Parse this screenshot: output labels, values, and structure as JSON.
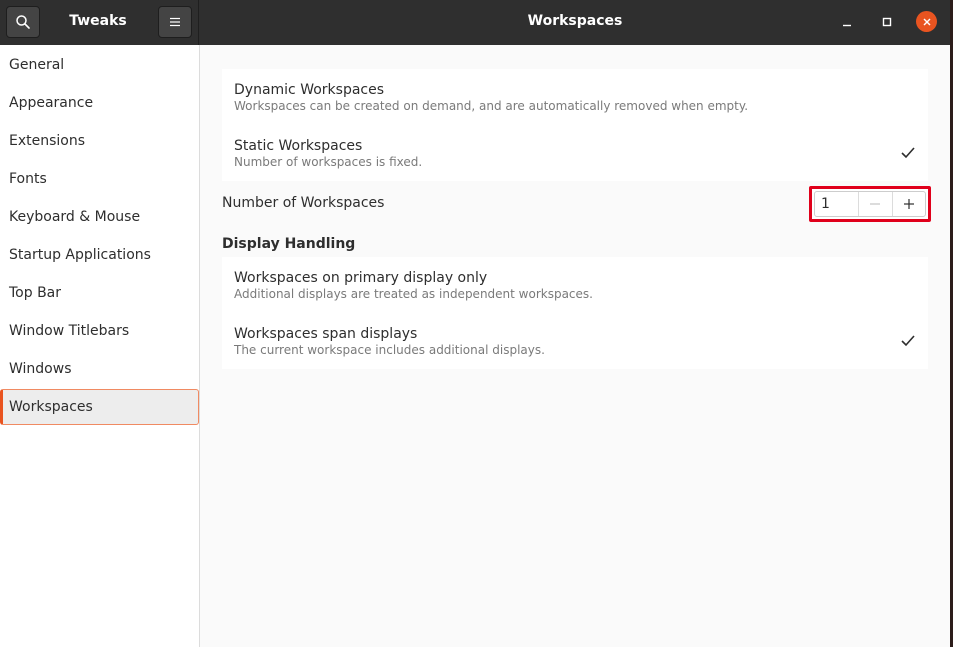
{
  "header": {
    "app_title": "Tweaks",
    "window_title": "Workspaces",
    "icons": {
      "search": "search-icon",
      "menu": "hamburger-menu-icon",
      "minimize": "minimize-icon",
      "maximize": "maximize-icon",
      "close": "close-icon"
    }
  },
  "sidebar": {
    "items": [
      {
        "label": "General"
      },
      {
        "label": "Appearance"
      },
      {
        "label": "Extensions"
      },
      {
        "label": "Fonts"
      },
      {
        "label": "Keyboard & Mouse"
      },
      {
        "label": "Startup Applications"
      },
      {
        "label": "Top Bar"
      },
      {
        "label": "Window Titlebars"
      },
      {
        "label": "Windows"
      },
      {
        "label": "Workspaces"
      }
    ],
    "selected": "Workspaces"
  },
  "main": {
    "workspace_mode": {
      "options": [
        {
          "title": "Dynamic Workspaces",
          "subtitle": "Workspaces can be created on demand, and are automatically removed when empty.",
          "checked": false
        },
        {
          "title": "Static Workspaces",
          "subtitle": "Number of workspaces is fixed.",
          "checked": true
        }
      ]
    },
    "number_of_workspaces": {
      "label": "Number of Workspaces",
      "value": "1",
      "decrement": "−",
      "increment": "+"
    },
    "display_handling": {
      "heading": "Display Handling",
      "options": [
        {
          "title": "Workspaces on primary display only",
          "subtitle": "Additional displays are treated as independent workspaces.",
          "checked": false
        },
        {
          "title": "Workspaces span displays",
          "subtitle": "The current workspace includes additional displays.",
          "checked": true
        }
      ]
    }
  },
  "colors": {
    "accent": "#e95420",
    "headerbar": "#2f2f2f",
    "highlight_box": "#e0001b"
  }
}
